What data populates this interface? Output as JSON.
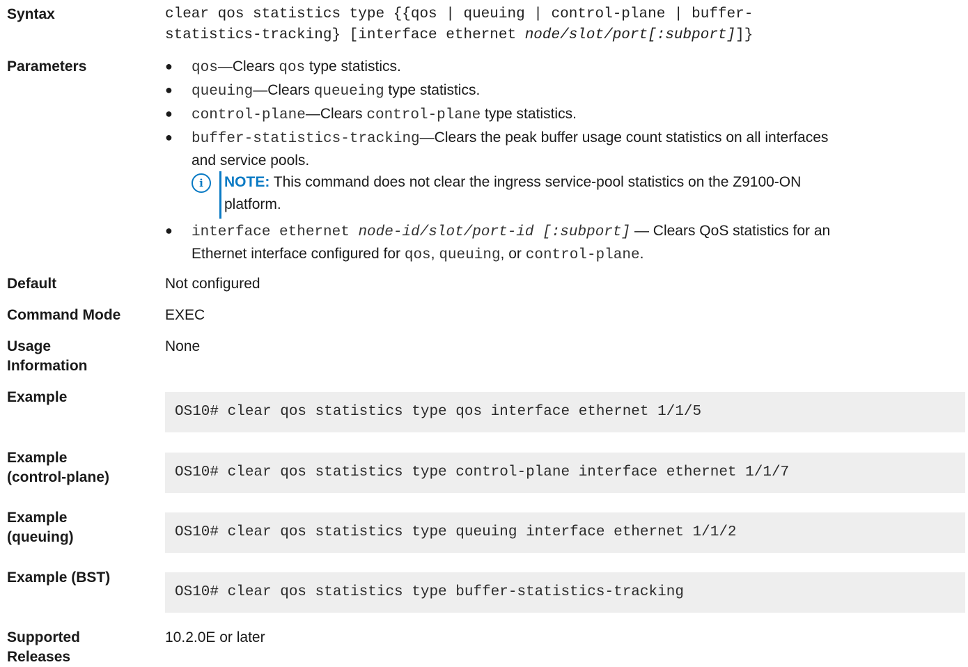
{
  "labels": {
    "syntax": "Syntax",
    "parameters": "Parameters",
    "default": "Default",
    "command_mode": "Command Mode",
    "usage_line1": "Usage",
    "usage_line2": "Information",
    "example": "Example",
    "example_cp_line1": "Example",
    "example_cp_line2": "(control-plane)",
    "example_q_line1": "Example",
    "example_q_line2": "(queuing)",
    "example_bst": "Example (BST)",
    "supported_line1": "Supported",
    "supported_line2": "Releases"
  },
  "syntax": {
    "line1": "clear qos statistics type {{qos | queuing | control-plane | buffer-",
    "line2_prefix": "statistics-tracking} [interface ethernet ",
    "line2_italic": "node/slot/port[:subport]",
    "line2_suffix": "]}"
  },
  "parameters": [
    {
      "code": "qos",
      "mid1": "—Clears ",
      "code2": "qos",
      "rest": " type statistics."
    },
    {
      "code": "queuing",
      "mid1": "—Clears ",
      "code2": "queueing",
      "rest": " type statistics."
    },
    {
      "code": "control-plane",
      "mid1": "—Clears ",
      "code2": "control-plane",
      "rest": " type statistics."
    },
    {
      "code": "buffer-statistics-tracking",
      "line1": "—Clears the peak buffer usage count statistics on all interfaces",
      "line2": "and service pools."
    }
  ],
  "note": {
    "label": "NOTE:",
    "line1": " This command does not clear the ingress service-pool statistics on the Z9100-ON",
    "line2": "platform."
  },
  "last_param": {
    "code": "interface ethernet ",
    "italic": "node-id/slot/port-id [:subport]",
    "text1": " — Clears QoS statistics for an",
    "line2_a": "Ethernet interface configured for ",
    "code_a": "qos",
    "sep1": ", ",
    "code_b": "queuing",
    "sep2": ", or ",
    "code_c": "control-plane",
    "end": "."
  },
  "default_value": "Not configured",
  "command_mode_value": "EXEC",
  "usage_value": "None",
  "examples": {
    "example": "OS10# clear qos statistics type qos interface ethernet 1/1/5",
    "control_plane": "OS10# clear qos statistics type control-plane interface ethernet 1/1/7",
    "queuing": "OS10# clear qos statistics type queuing interface ethernet 1/1/2",
    "bst": "OS10# clear qos statistics type buffer-statistics-tracking"
  },
  "supported_value": "10.2.0E or later",
  "colors": {
    "accent": "#0a7ac4",
    "code_bg": "#eeeeee"
  }
}
